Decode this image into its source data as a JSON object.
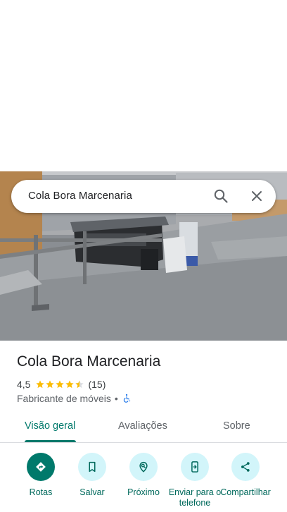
{
  "search": {
    "query": "Cola Bora Marcenaria",
    "search_icon": "search-icon",
    "close_icon": "close-icon"
  },
  "place": {
    "name": "Cola Bora Marcenaria",
    "rating": "4,5",
    "rating_value": 4.5,
    "rating_max": 5,
    "review_count": "(15)",
    "category": "Fabricante de móveis",
    "separator": "•",
    "accessibility_icon": "wheelchair-icon"
  },
  "tabs": [
    {
      "label": "Visão geral",
      "active": true
    },
    {
      "label": "Avaliações",
      "active": false
    },
    {
      "label": "Sobre",
      "active": false
    }
  ],
  "actions": [
    {
      "label": "Rotas",
      "icon": "directions-icon"
    },
    {
      "label": "Salvar",
      "icon": "bookmark-icon"
    },
    {
      "label": "Próximo",
      "icon": "nearby-icon"
    },
    {
      "label": "Enviar para o telefone",
      "icon": "send-to-phone-icon"
    },
    {
      "label": "Compartilhar",
      "icon": "share-icon"
    }
  ],
  "colors": {
    "accent": "#00796b",
    "action_bg": "#d2f5fa",
    "star": "#fbbc04",
    "accessibility": "#1a73e8"
  }
}
